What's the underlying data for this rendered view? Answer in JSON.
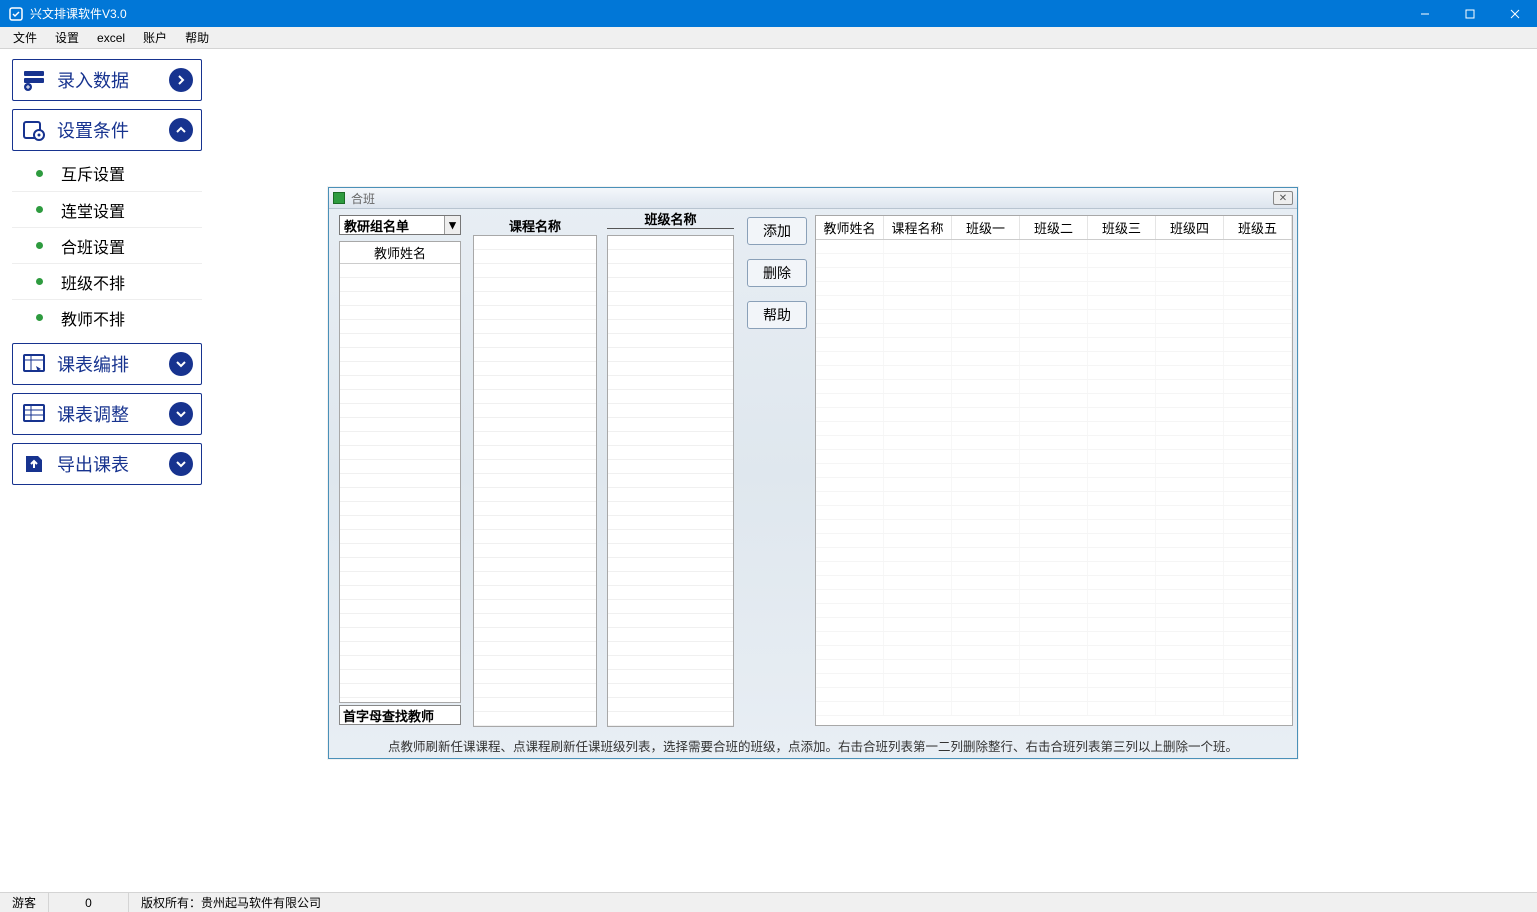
{
  "window": {
    "title": "兴文排课软件V3.0"
  },
  "menu": [
    "文件",
    "设置",
    "excel",
    "账户",
    "帮助"
  ],
  "nav": {
    "input_data": "录入数据",
    "set_cond": "设置条件",
    "sub_items": [
      "互斥设置",
      "连堂设置",
      "合班设置",
      "班级不排",
      "教师不排"
    ],
    "schedule_arrange": "课表编排",
    "schedule_adjust": "课表调整",
    "export": "导出课表"
  },
  "inner": {
    "title": "合班",
    "teacher_group_dropdown": "教研组名单",
    "teacher_name_header": "教师姓名",
    "course_name_header": "课程名称",
    "class_name_header": "班级名称",
    "search_label": "首字母查找教师",
    "buttons": {
      "add": "添加",
      "delete": "删除",
      "help": "帮助"
    },
    "grid_headers": [
      "教师姓名",
      "课程名称",
      "班级一",
      "班级二",
      "班级三",
      "班级四",
      "班级五"
    ],
    "hint": "点教师刷新任课课程、点课程刷新任课班级列表，选择需要合班的班级，点添加。右击合班列表第一二列删除整行、右击合班列表第三列以上删除一个班。"
  },
  "status": {
    "user": "游客",
    "count": "0",
    "copyright_label": "版权所有：",
    "copyright_owner": "贵州起马软件有限公司"
  }
}
